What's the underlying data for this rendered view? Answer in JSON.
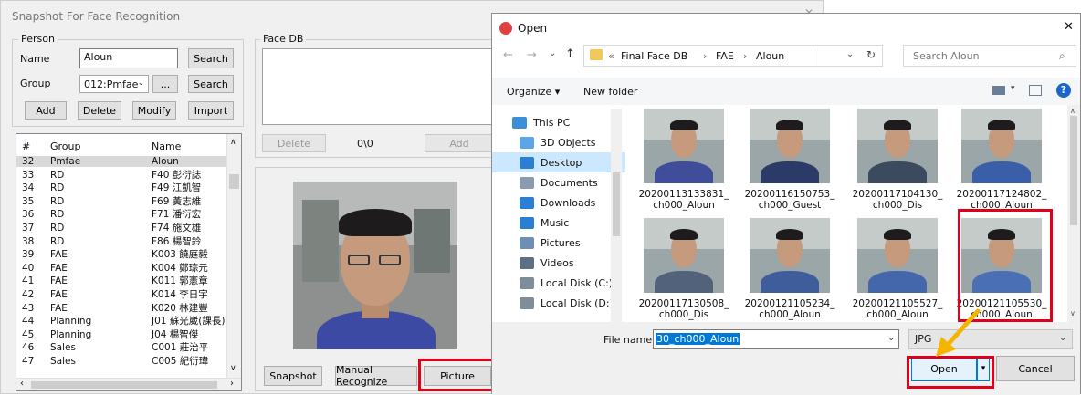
{
  "app": {
    "title": "Snapshot For Face Recognition",
    "close_glyph": "✕",
    "person": {
      "group_label": "Person",
      "name_label": "Name",
      "name_value": "Aloun",
      "search_label": "Search",
      "group_field_label": "Group",
      "group_value": "012:Pmfae",
      "browse_label": "...",
      "search2_label": "Search",
      "add_label": "Add",
      "delete_label": "Delete",
      "modify_label": "Modify",
      "import_label": "Import"
    },
    "list": {
      "col_num": "#",
      "col_group": "Group",
      "col_name": "Name",
      "rows": [
        {
          "num": "32",
          "group": "Pmfae",
          "name": "Aloun"
        },
        {
          "num": "33",
          "group": "RD",
          "name": "F40 彭衍誌"
        },
        {
          "num": "34",
          "group": "RD",
          "name": "F49 江凱智"
        },
        {
          "num": "35",
          "group": "RD",
          "name": "F69 黃志維"
        },
        {
          "num": "36",
          "group": "RD",
          "name": "F71 潘衍宏"
        },
        {
          "num": "37",
          "group": "RD",
          "name": "F74 施文雄"
        },
        {
          "num": "38",
          "group": "RD",
          "name": "F86 楊智鈴"
        },
        {
          "num": "39",
          "group": "FAE",
          "name": "K003 饒庭毅"
        },
        {
          "num": "40",
          "group": "FAE",
          "name": "K004 鄭琮元"
        },
        {
          "num": "41",
          "group": "FAE",
          "name": "K011 郭憲章"
        },
        {
          "num": "42",
          "group": "FAE",
          "name": "K014 李日宇"
        },
        {
          "num": "43",
          "group": "FAE",
          "name": "K020 林建豐"
        },
        {
          "num": "44",
          "group": "Planning",
          "name": "J01 蘇光崴(課長)"
        },
        {
          "num": "45",
          "group": "Planning",
          "name": "J04 楊智傑"
        },
        {
          "num": "46",
          "group": "Sales",
          "name": "C001 莊治平"
        },
        {
          "num": "47",
          "group": "Sales",
          "name": "C005 紀衍瑋"
        }
      ]
    },
    "facedb": {
      "label": "Face DB",
      "delete_label": "Delete",
      "counter": "0\\0",
      "add_label": "Add"
    },
    "snapshot_label": "Snapshot",
    "manual_recognize_label": "Manual Recognize",
    "picture_label": "Picture"
  },
  "dialog": {
    "title": "Open",
    "close_glyph": "✕",
    "breadcrumb": [
      "Final Face DB",
      "FAE",
      "Aloun"
    ],
    "breadcrumb_prefix": "«",
    "search_placeholder": "Search Aloun",
    "organize_label": "Organize ▾",
    "new_folder_label": "New folder",
    "nav_items": [
      {
        "label": "This PC",
        "color": "#3b8fd9"
      },
      {
        "label": "3D Objects",
        "color": "#5aa6e8"
      },
      {
        "label": "Desktop",
        "color": "#2a7fd4"
      },
      {
        "label": "Documents",
        "color": "#8a9bb0"
      },
      {
        "label": "Downloads",
        "color": "#2a7fd4"
      },
      {
        "label": "Music",
        "color": "#2a7fd4"
      },
      {
        "label": "Pictures",
        "color": "#6d8fb5"
      },
      {
        "label": "Videos",
        "color": "#5c6f85"
      },
      {
        "label": "Local Disk (C:)",
        "color": "#7f8c99"
      },
      {
        "label": "Local Disk (D:)",
        "color": "#7f8c99"
      }
    ],
    "files": [
      {
        "name1": "20200113133831_",
        "name2": "ch000_Aloun",
        "shirt": "#3f4d9a"
      },
      {
        "name1": "20200116150753_",
        "name2": "ch000_Guest",
        "shirt": "#2b3a66"
      },
      {
        "name1": "20200117104130_",
        "name2": "ch000_Dis",
        "shirt": "#3b4a5e"
      },
      {
        "name1": "20200117124802_",
        "name2": "ch000_Aloun",
        "shirt": "#3b5ea8"
      },
      {
        "name1": "20200117130508_",
        "name2": "ch000_Dis",
        "shirt": "#52627a"
      },
      {
        "name1": "20200121105234_",
        "name2": "ch000_Aloun",
        "shirt": "#3f5d9a"
      },
      {
        "name1": "20200121105527_",
        "name2": "ch000_Aloun",
        "shirt": "#4466aa"
      },
      {
        "name1": "20200121105530_",
        "name2": "ch000_Aloun",
        "shirt": "#4a6fb5"
      }
    ],
    "filename_label": "File name:",
    "filename_value": "30_ch000_Aloun",
    "filetype_value": "JPG",
    "open_label": "Open",
    "cancel_label": "Cancel"
  },
  "colors": {
    "highlight": "#e0001b",
    "arrow": "#f4b400",
    "selection": "#cce8ff",
    "accent": "#0078d7"
  }
}
